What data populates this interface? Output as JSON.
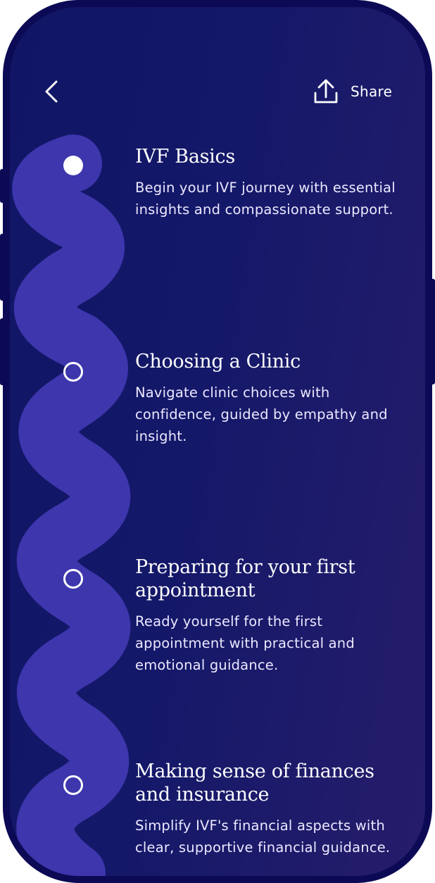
{
  "header": {
    "share_label": "Share"
  },
  "icons": {
    "back": "chevron-left-icon",
    "share": "share-upload-icon"
  },
  "steps": [
    {
      "title": "IVF Basics",
      "description": "Begin your IVF journey with essential insights and compassionate support.",
      "status": "current"
    },
    {
      "title": "Choosing a Clinic",
      "description": "Navigate clinic choices with confidence, guided by empathy and insight.",
      "status": "upcoming"
    },
    {
      "title": "Preparing for your first appointment",
      "description": "Ready yourself for the first appointment with practical and emotional guidance.",
      "status": "upcoming"
    },
    {
      "title": "Making sense of finances and insurance",
      "description": "Simplify IVF's financial aspects with clear, supportive financial guidance.",
      "status": "upcoming"
    }
  ],
  "colors": {
    "background_start": "#111565",
    "background_end": "#261d6a",
    "path": "#3d36ad",
    "text": "#ffffff",
    "frame": "#0c0a55"
  }
}
